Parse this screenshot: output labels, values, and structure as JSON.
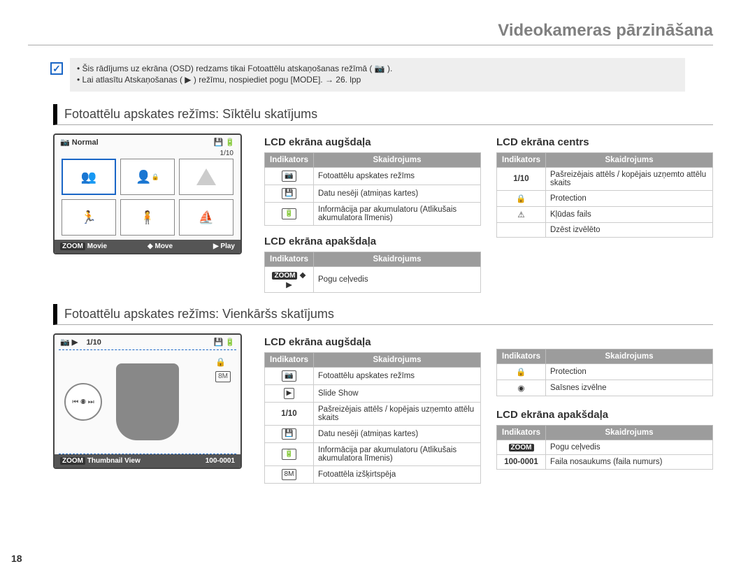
{
  "page_title": "Videokameras pārzināšana",
  "page_number": "18",
  "note": {
    "line1": "Šis rādījums uz ekrāna (OSD) redzams tikai Fotoattēlu atskaņošanas režīmā ( 📷 ).",
    "line2": "Lai atlasītu Atskaņošanas ( ▶ ) režīmu, nospiediet pogu [MODE]. → 26. lpp"
  },
  "section1": {
    "title": "Fotoattēlu apskates režīms: Sīktēlu skatījums",
    "lcd": {
      "top_label": "Normal",
      "counter": "1/10",
      "bot_zoom": "ZOOM",
      "bot_movie": "Movie",
      "bot_move": "Move",
      "bot_play": "Play"
    },
    "top": {
      "heading": "LCD ekrāna augšdaļa",
      "th1": "Indikators",
      "th2": "Skaidrojums",
      "rows": [
        {
          "icon": "📷",
          "text": "Fotoattēlu apskates režīms"
        },
        {
          "icon": "💾",
          "text": "Datu nesēji (atmiņas kartes)"
        },
        {
          "icon": "🔋",
          "text": "Informācija par akumulatoru (Atlikušais akumulatora līmenis)"
        }
      ]
    },
    "bottom": {
      "heading": "LCD ekrāna apakšdaļa",
      "th1": "Indikators",
      "th2": "Skaidrojums",
      "rows": [
        {
          "icon": "ZOOM ◆ ▶",
          "text": "Pogu ceļvedis"
        }
      ]
    },
    "center": {
      "heading": "LCD ekrāna centrs",
      "th1": "Indikators",
      "th2": "Skaidrojums",
      "rows": [
        {
          "icon": "1/10",
          "text": "Pašreizējais attēls / kopējais uzņemto attēlu skaits"
        },
        {
          "icon": "🔒",
          "text": "Protection"
        },
        {
          "icon": "⚠",
          "text": "Kļūdas fails"
        },
        {
          "icon": "",
          "text": "Dzēst izvēlēto"
        }
      ]
    }
  },
  "section2": {
    "title": "Fotoattēlu apskates režīms: Vienkāršs skatījums",
    "lcd": {
      "counter": "1/10",
      "bot_zoom": "ZOOM",
      "bot_thumb": "Thumbnail View",
      "bot_file": "100-0001"
    },
    "top": {
      "heading": "LCD ekrāna augšdaļa",
      "th1": "Indikators",
      "th2": "Skaidrojums",
      "rows": [
        {
          "icon": "📷",
          "text": "Fotoattēlu apskates režīms"
        },
        {
          "icon": "▶",
          "text": "Slide Show"
        },
        {
          "icon": "1/10",
          "text": "Pašreizējais attēls / kopējais uzņemto attēlu skaits"
        },
        {
          "icon": "💾",
          "text": "Datu nesēji (atmiņas kartes)"
        },
        {
          "icon": "🔋",
          "text": "Informācija par akumulatoru (Atlikušais akumulatora līmenis)"
        },
        {
          "icon": "8M",
          "text": "Fotoattēla izšķirtspēja"
        }
      ]
    },
    "right_top": {
      "th1": "Indikators",
      "th2": "Skaidrojums",
      "rows": [
        {
          "icon": "🔒",
          "text": "Protection"
        },
        {
          "icon": "◉",
          "text": "Saīsnes izvēlne"
        }
      ]
    },
    "bottom": {
      "heading": "LCD ekrāna apakšdaļa",
      "th1": "Indikators",
      "th2": "Skaidrojums",
      "rows": [
        {
          "icon": "ZOOM",
          "text": "Pogu ceļvedis"
        },
        {
          "icon": "100-0001",
          "text": "Faila nosaukums (faila numurs)"
        }
      ]
    }
  }
}
